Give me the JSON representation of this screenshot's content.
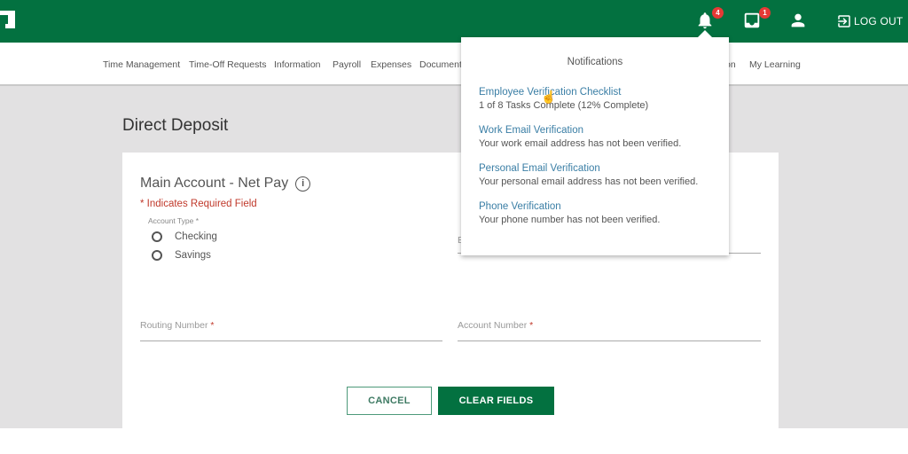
{
  "topbar": {
    "notifications_count": "4",
    "inbox_count": "1",
    "logout_label": "LOG OUT"
  },
  "nav": {
    "items": [
      "Time Management",
      "Time-Off Requests",
      "Information",
      "Payroll",
      "Expenses",
      "Document",
      "on",
      "My Learning"
    ]
  },
  "page": {
    "title": "Direct Deposit",
    "section_title": "Main Account - Net Pay",
    "required_note": "* Indicates Required Field",
    "account_type_label": "Account Type *",
    "account_type_options": [
      "Checking",
      "Savings"
    ],
    "partial_field_label": "E",
    "routing_label": "Routing Number",
    "account_label": "Account Number",
    "required_star": "*",
    "cancel_label": "CANCEL",
    "clear_label": "CLEAR FIELDS"
  },
  "notifications": {
    "title": "Notifications",
    "items": [
      {
        "title": "Employee Verification Checklist",
        "desc": "1 of 8 Tasks Complete (12% Complete)"
      },
      {
        "title": "Work Email Verification",
        "desc": "Your work email address has not been verified."
      },
      {
        "title": "Personal Email Verification",
        "desc": "Your personal email address has not been verified."
      },
      {
        "title": "Phone Verification",
        "desc": "Your phone number has not been verified."
      }
    ]
  },
  "colors": {
    "brand_green": "#037140",
    "link_blue": "#3a7ea5",
    "required_red": "#c0392b",
    "badge_red": "#e53935"
  }
}
